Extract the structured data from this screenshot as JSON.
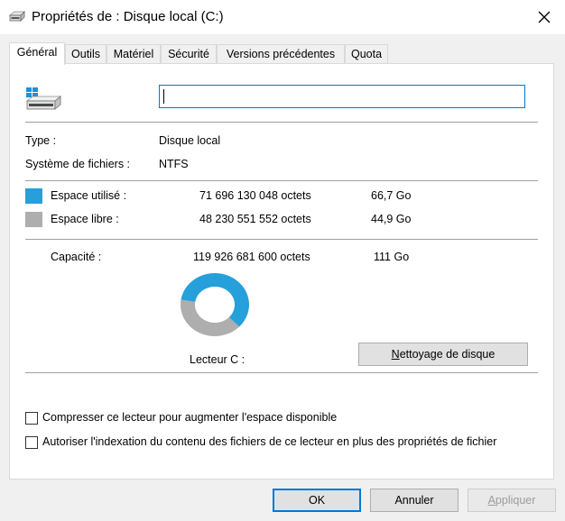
{
  "window": {
    "title": "Propriétés de : Disque local (C:)"
  },
  "tabs": [
    {
      "label": "Général",
      "active": true
    },
    {
      "label": "Outils"
    },
    {
      "label": "Matériel"
    },
    {
      "label": "Sécurité"
    },
    {
      "label": "Versions précédentes"
    },
    {
      "label": "Quota"
    }
  ],
  "general": {
    "name_value": "",
    "type_label": "Type :",
    "type_value": "Disque local",
    "fs_label": "Système de fichiers :",
    "fs_value": "NTFS",
    "used": {
      "label": "Espace utilisé :",
      "bytes": "71 696 130 048 octets",
      "size": "66,7 Go",
      "color": "#26a0da"
    },
    "free": {
      "label": "Espace libre :",
      "bytes": "48 230 551 552 octets",
      "size": "44,9 Go",
      "color": "#aeaeae"
    },
    "capacity": {
      "label": "Capacité :",
      "bytes": "119 926 681 600 octets",
      "size": "111 Go"
    },
    "drive_label": "Lecteur C :",
    "cleanup_button": "Nettoyage de disque",
    "compress_checkbox": {
      "label": "Compresser ce lecteur pour augmenter l'espace disponible",
      "checked": false
    },
    "index_checkbox": {
      "label": "Autoriser l'indexation du contenu des fichiers de ce lecteur en plus des propriétés de fichier",
      "checked": false
    }
  },
  "buttons": {
    "ok": "OK",
    "cancel": "Annuler",
    "apply": "Appliquer"
  },
  "icons": {
    "title": "drive-icon",
    "drive": "windows-drive-icon",
    "close": "close-icon"
  }
}
